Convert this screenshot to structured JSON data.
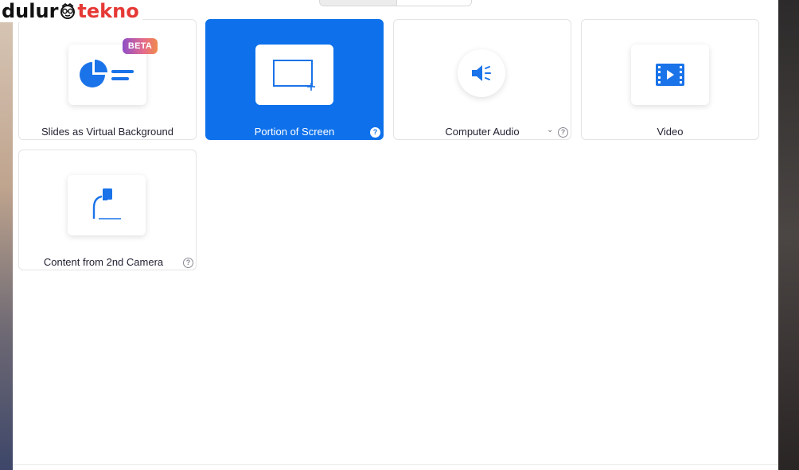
{
  "watermark": {
    "part1": "dulur",
    "part2": "tekno"
  },
  "share_options": [
    {
      "label": "Slides as Virtual Background",
      "badge": "BETA",
      "icon": "slides-icon",
      "selected": false
    },
    {
      "label": "Portion of Screen",
      "icon": "portion-screen-icon",
      "selected": true,
      "help": "?"
    },
    {
      "label": "Computer Audio",
      "icon": "speaker-icon",
      "selected": false,
      "help": "?",
      "dropdown": "⌄"
    },
    {
      "label": "Video",
      "icon": "video-film-icon",
      "selected": false
    },
    {
      "label": "Content from 2nd Camera",
      "icon": "document-camera-icon",
      "selected": false,
      "help": "?"
    }
  ],
  "colors": {
    "accent": "#0e71eb",
    "icon_blue": "#1a73e8",
    "card_border": "#e4e4e4",
    "text": "#232333"
  }
}
